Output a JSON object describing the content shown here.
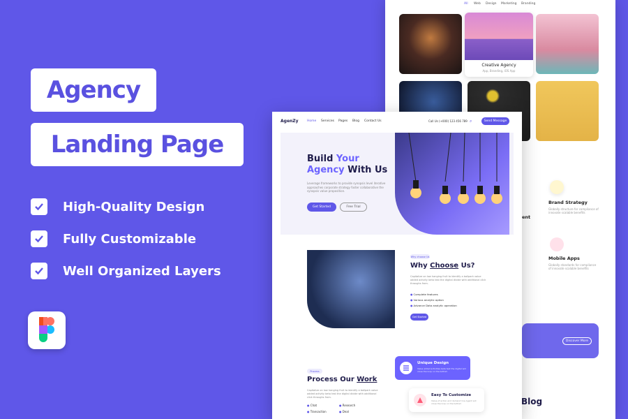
{
  "headline": {
    "line1": "Agency",
    "line2": "Landing Page"
  },
  "features": [
    "High-Quality Design",
    "Fully Customizable",
    "Well Organized Layers"
  ],
  "back_page": {
    "nav": [
      "All",
      "Web",
      "Design",
      "Marketing",
      "Branding"
    ],
    "portfolio_caption": {
      "title": "Creative Agency",
      "subtitle": "App, Branding, iOS App"
    },
    "services": [
      {
        "title": "Brand Strategy",
        "desc": "Globally structure for compliance of innovate scalable benefits"
      },
      {
        "title": "Mobile Apps",
        "desc": "Globally standards for compliance of innovate scalable benefits"
      }
    ],
    "partial_label": "ent",
    "cta_button": "Discover More",
    "blog_heading": "Blog"
  },
  "front_page": {
    "logo": "AgenZy",
    "nav": [
      "Home",
      "Services",
      "Pages",
      "Blog",
      "Contact Us"
    ],
    "phone": "Call Us (+000) 123 456 789",
    "send_button": "Send Message",
    "hero": {
      "title_1": "Build ",
      "title_1b": "Your",
      "title_2": "Agency",
      "title_2b": " With Us",
      "desc": "Leverage frameworks to provide synopsis level iterative approaches corporate strategy foster collaborative the synopsis value proposition.",
      "primary_button": "Get Started",
      "secondary_button": "Free Trial"
    },
    "why": {
      "tag": "Why choose Us",
      "title_a": "Why ",
      "title_b": "Choose",
      "title_c": " Us?",
      "desc": "Capitalize on low hanging fruit to identify a ballpark value added activity beta test the digital divide with additional click throughs from.",
      "bullets": [
        "Complete features",
        "Various analytic option",
        "Advance Data analytic operation"
      ],
      "button": "Get Started"
    },
    "process": {
      "tag": "Process",
      "title_a": "Process Our ",
      "title_b": "Work",
      "desc": "Capitalize on low hanging fruit to identify a ballpark value added activity beta test the digital divide with additional click throughs from.",
      "items": [
        "Chat",
        "Research",
        "Transaction",
        "Deal"
      ]
    },
    "cards": [
      {
        "title": "Unique Design",
        "desc": "Value added activities beta test the digital will close the loop on the bottom"
      },
      {
        "title": "Easy To Customize",
        "desc": "Value-of action and demand line Agent will close the loop on the bottom"
      }
    ]
  },
  "colors": {
    "brand": "#5f57e8",
    "accent": "#6c63ff",
    "text": "#1f1c4a"
  }
}
